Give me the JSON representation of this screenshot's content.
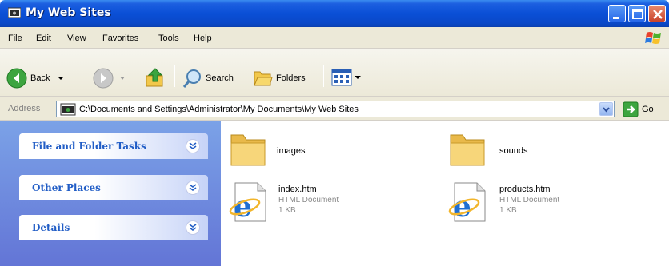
{
  "window": {
    "title": "My Web Sites",
    "icon": "folder-window-icon"
  },
  "menu": {
    "items": [
      {
        "accel": "F",
        "rest": "ile"
      },
      {
        "accel": "E",
        "rest": "dit"
      },
      {
        "accel": "V",
        "rest": "iew"
      },
      {
        "pre": "F",
        "accel": "a",
        "rest": "vorites"
      },
      {
        "accel": "T",
        "rest": "ools"
      },
      {
        "accel": "H",
        "rest": "elp"
      }
    ]
  },
  "toolbar": {
    "back_label": "Back",
    "search_label": "Search",
    "folders_label": "Folders"
  },
  "address": {
    "label": "Address",
    "value": "C:\\Documents and Settings\\Administrator\\My Documents\\My Web Sites",
    "go_label": "Go"
  },
  "tasks": [
    {
      "label": "File and Folder Tasks"
    },
    {
      "label": "Other Places"
    },
    {
      "label": "Details"
    }
  ],
  "files": [
    {
      "name": "images",
      "type": "",
      "size": "",
      "icon": "folder-icon"
    },
    {
      "name": "sounds",
      "type": "",
      "size": "",
      "icon": "folder-icon"
    },
    {
      "name": "index.htm",
      "type": "HTML Document",
      "size": "1 KB",
      "icon": "html-document-icon"
    },
    {
      "name": "products.htm",
      "type": "HTML Document",
      "size": "1 KB",
      "icon": "html-document-icon"
    }
  ],
  "colors": {
    "titlebar": "#0a4fd6",
    "taskpane": "#6f8ee0",
    "task_label": "#215dc6"
  }
}
